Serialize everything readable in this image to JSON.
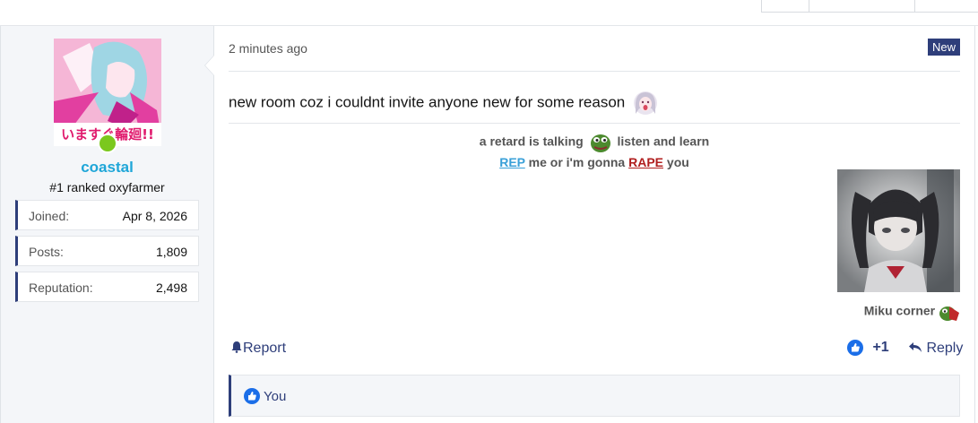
{
  "post": {
    "user": {
      "username": "coastal",
      "user_title": "#1 ranked oxyfarmer",
      "stats": [
        {
          "label": "Joined:",
          "value": "Apr 8, 2026"
        },
        {
          "label": "Posts:",
          "value": "1,809"
        },
        {
          "label": "Reputation:",
          "value": "2,498"
        }
      ],
      "avatar_text": "いますぐ輪廻!!"
    },
    "time": "2 minutes ago",
    "badge": "New",
    "message": "new room coz i couldnt invite anyone new for some reason",
    "signature": {
      "line1_a": "a retard is talking",
      "line1_b": "listen and learn",
      "line2_a": "REP",
      "line2_b": "me or i'm gonna",
      "line2_c": "RAPE",
      "line2_d": "you",
      "image_caption": "Miku corner"
    },
    "actions": {
      "report": "Report",
      "like_count": "+1",
      "reply": "Reply"
    },
    "reactions": {
      "label": "You"
    }
  },
  "colors": {
    "accent": "#2e3e7a",
    "username": "#1fa6d8",
    "online": "#7bc81e"
  }
}
